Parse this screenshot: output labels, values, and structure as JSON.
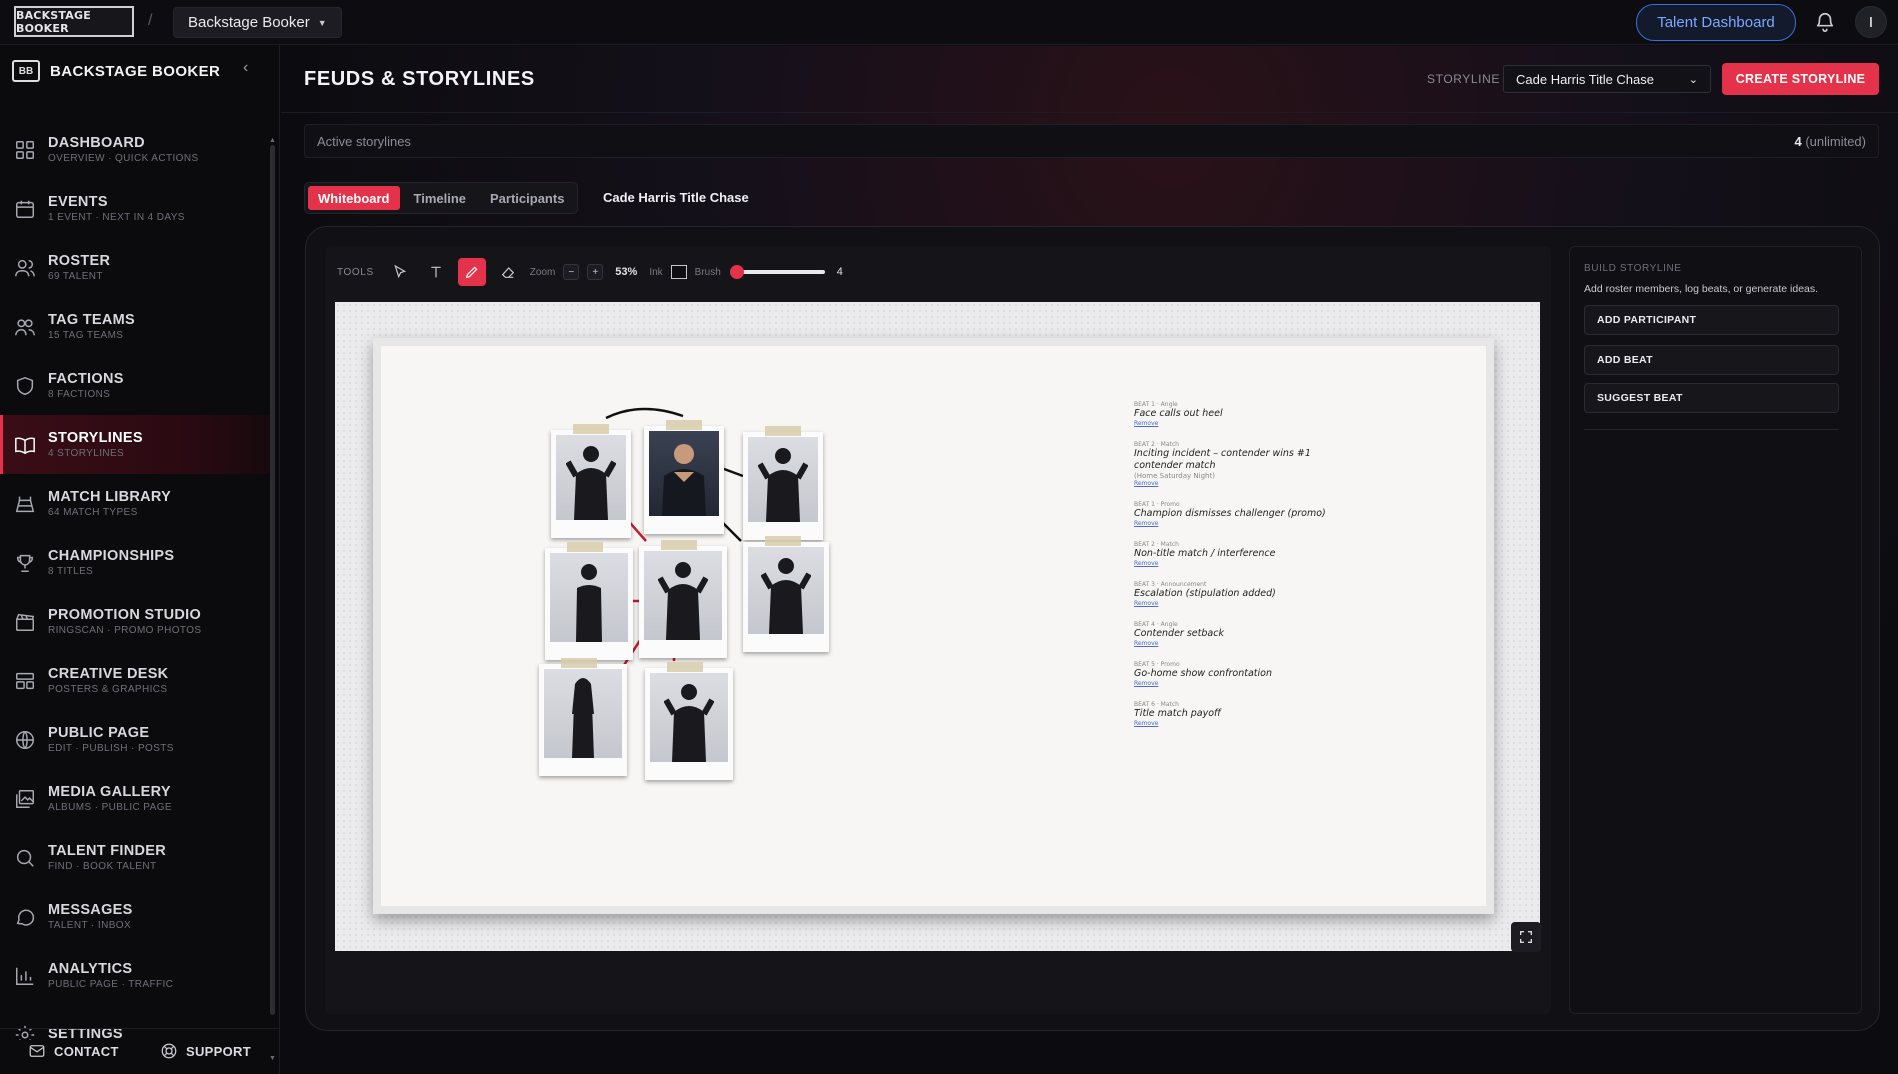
{
  "topbar": {
    "logo_text": "BACKSTAGE BOOKER",
    "app_selector": "Backstage Booker",
    "talent_dashboard": "Talent Dashboard",
    "avatar_initial": "I"
  },
  "sidebar": {
    "brand_badge": "BB",
    "brand_name": "BACKSTAGE BOOKER",
    "items": [
      {
        "label": "DASHBOARD",
        "sub": "OVERVIEW · QUICK ACTIONS",
        "icon": "grid-icon"
      },
      {
        "label": "EVENTS",
        "sub": "1 EVENT · NEXT IN 4 DAYS",
        "icon": "calendar-icon"
      },
      {
        "label": "ROSTER",
        "sub": "69 TALENT",
        "icon": "users-icon"
      },
      {
        "label": "TAG TEAMS",
        "sub": "15 TAG TEAMS",
        "icon": "user-pair-icon"
      },
      {
        "label": "FACTIONS",
        "sub": "8 FACTIONS",
        "icon": "shield-icon"
      },
      {
        "label": "STORYLINES",
        "sub": "4 STORYLINES",
        "icon": "book-icon",
        "active": true
      },
      {
        "label": "MATCH LIBRARY",
        "sub": "64 MATCH TYPES",
        "icon": "ring-icon"
      },
      {
        "label": "CHAMPIONSHIPS",
        "sub": "8 TITLES",
        "icon": "trophy-icon"
      },
      {
        "label": "PROMOTION STUDIO",
        "sub": "RINGSCAN · PROMO PHOTOS",
        "icon": "clapper-icon"
      },
      {
        "label": "CREATIVE DESK",
        "sub": "POSTERS & GRAPHICS",
        "icon": "layout-icon"
      },
      {
        "label": "PUBLIC PAGE",
        "sub": "EDIT · PUBLISH · POSTS",
        "icon": "globe-icon"
      },
      {
        "label": "MEDIA GALLERY",
        "sub": "ALBUMS · PUBLIC PAGE",
        "icon": "images-icon"
      },
      {
        "label": "TALENT FINDER",
        "sub": "FIND · BOOK TALENT",
        "icon": "search-icon"
      },
      {
        "label": "MESSAGES",
        "sub": "TALENT · INBOX",
        "icon": "chat-icon"
      },
      {
        "label": "ANALYTICS",
        "sub": "PUBLIC PAGE · TRAFFIC",
        "icon": "bar-chart-icon"
      },
      {
        "label": "SETTINGS",
        "sub": "",
        "icon": "gear-icon"
      }
    ],
    "footer": {
      "contact": "CONTACT",
      "support": "SUPPORT"
    }
  },
  "header": {
    "title": "FEUDS & STORYLINES",
    "storyline_label": "STORYLINE",
    "storyline_selected": "Cade Harris Title Chase",
    "create_button": "CREATE STORYLINE"
  },
  "active_bar": {
    "label": "Active storylines",
    "count": "4",
    "limit": "(unlimited)"
  },
  "tabs": [
    {
      "label": "Whiteboard",
      "active": true
    },
    {
      "label": "Timeline",
      "active": false
    },
    {
      "label": "Participants",
      "active": false
    }
  ],
  "storyline_title": "Cade Harris Title Chase",
  "toolbar": {
    "tools_label": "TOOLS",
    "zoom_label": "Zoom",
    "zoom_minus": "−",
    "zoom_plus": "+",
    "zoom_value": "53%",
    "ink_label": "Ink",
    "brush_label": "Brush",
    "brush_value": "4",
    "brush_fraction": 0.05
  },
  "whiteboard": {
    "beats": [
      {
        "meta": "BEAT 1 · Angle",
        "text": "Face calls out heel",
        "link": "Remove"
      },
      {
        "meta": "BEAT 2 · Match",
        "text": "Inciting incident – contender wins #1 contender match",
        "note": "(Home Saturday Night)",
        "link": "Remove"
      },
      {
        "meta": "BEAT 1 · Promo",
        "text": "Champion dismisses challenger (promo)",
        "link": "Remove"
      },
      {
        "meta": "BEAT 2 · Match",
        "text": "Non-title match / interference",
        "link": "Remove"
      },
      {
        "meta": "BEAT 3 · Announcement",
        "text": "Escalation (stipulation added)",
        "link": "Remove"
      },
      {
        "meta": "BEAT 4 · Angle",
        "text": "Contender setback",
        "link": "Remove"
      },
      {
        "meta": "BEAT 5 · Promo",
        "text": "Go-home show confrontation",
        "link": "Remove"
      },
      {
        "meta": "BEAT 6 · Match",
        "text": "Title match payoff",
        "link": "Remove"
      }
    ]
  },
  "build_panel": {
    "title": "BUILD STORYLINE",
    "subtitle": "Add roster members, log beats, or generate ideas.",
    "buttons": [
      "ADD PARTICIPANT",
      "ADD BEAT",
      "SUGGEST BEAT"
    ]
  },
  "colors": {
    "accent": "#e3324a",
    "link_blue": "#3b6fd9",
    "background": "#0c0c10"
  }
}
